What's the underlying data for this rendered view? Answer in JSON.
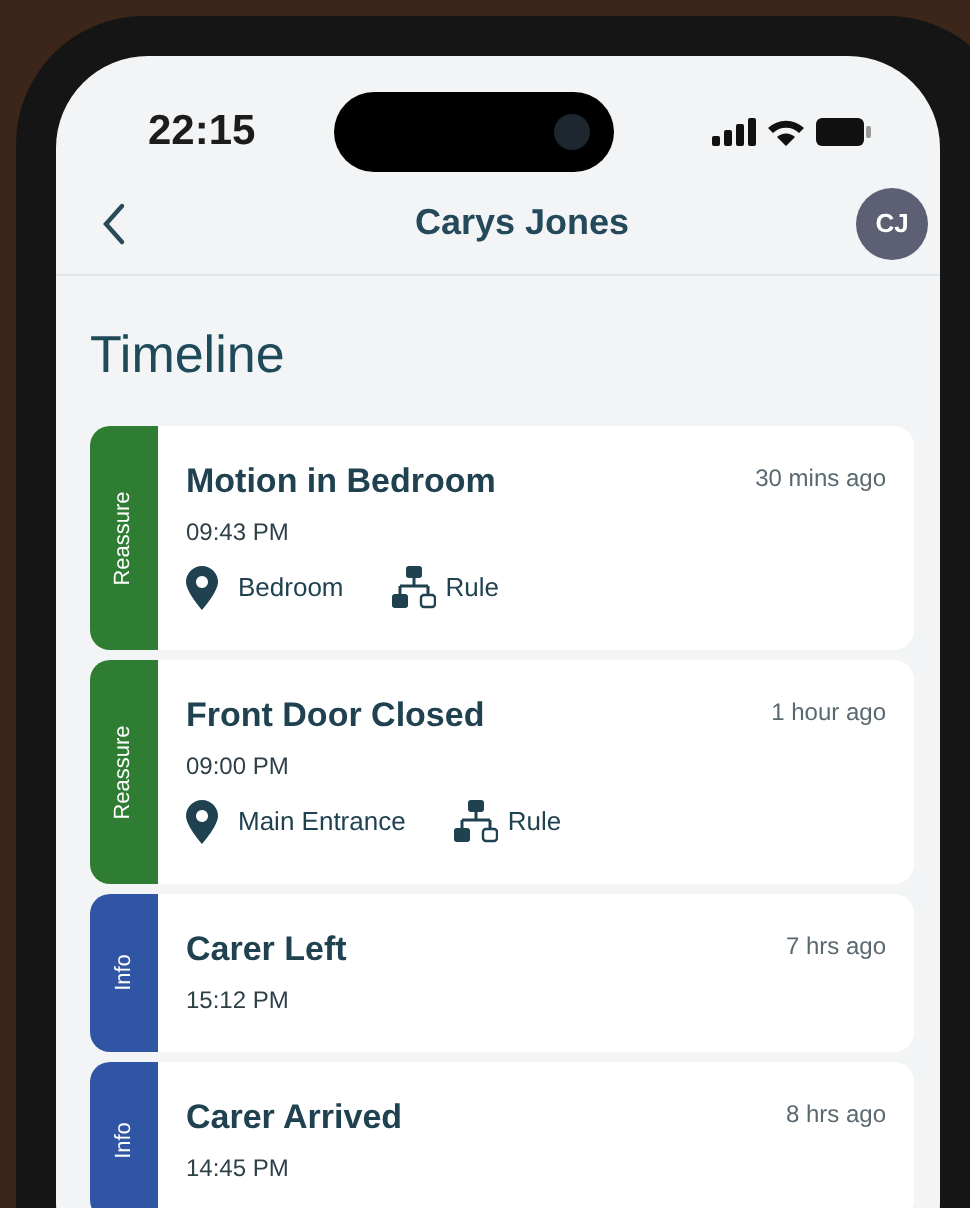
{
  "status_bar": {
    "time": "22:15"
  },
  "header": {
    "title": "Carys Jones",
    "avatar_initials": "CJ"
  },
  "heading": "Timeline",
  "events": [
    {
      "category": "Reassure",
      "color": "#2e7d32",
      "title": "Motion in Bedroom",
      "time": "09:43 PM",
      "ago": "30 mins ago",
      "location": "Bedroom",
      "source": "Rule"
    },
    {
      "category": "Reassure",
      "color": "#2e7d32",
      "title": "Front Door Closed",
      "time": "09:00 PM",
      "ago": "1 hour ago",
      "location": "Main Entrance",
      "source": "Rule"
    },
    {
      "category": "Info",
      "color": "#2f55a4",
      "title": "Carer Left",
      "time": "15:12 PM",
      "ago": "7 hrs ago"
    },
    {
      "category": "Info",
      "color": "#2f55a4",
      "title": "Carer Arrived",
      "time": "14:45 PM",
      "ago": "8 hrs ago"
    }
  ]
}
